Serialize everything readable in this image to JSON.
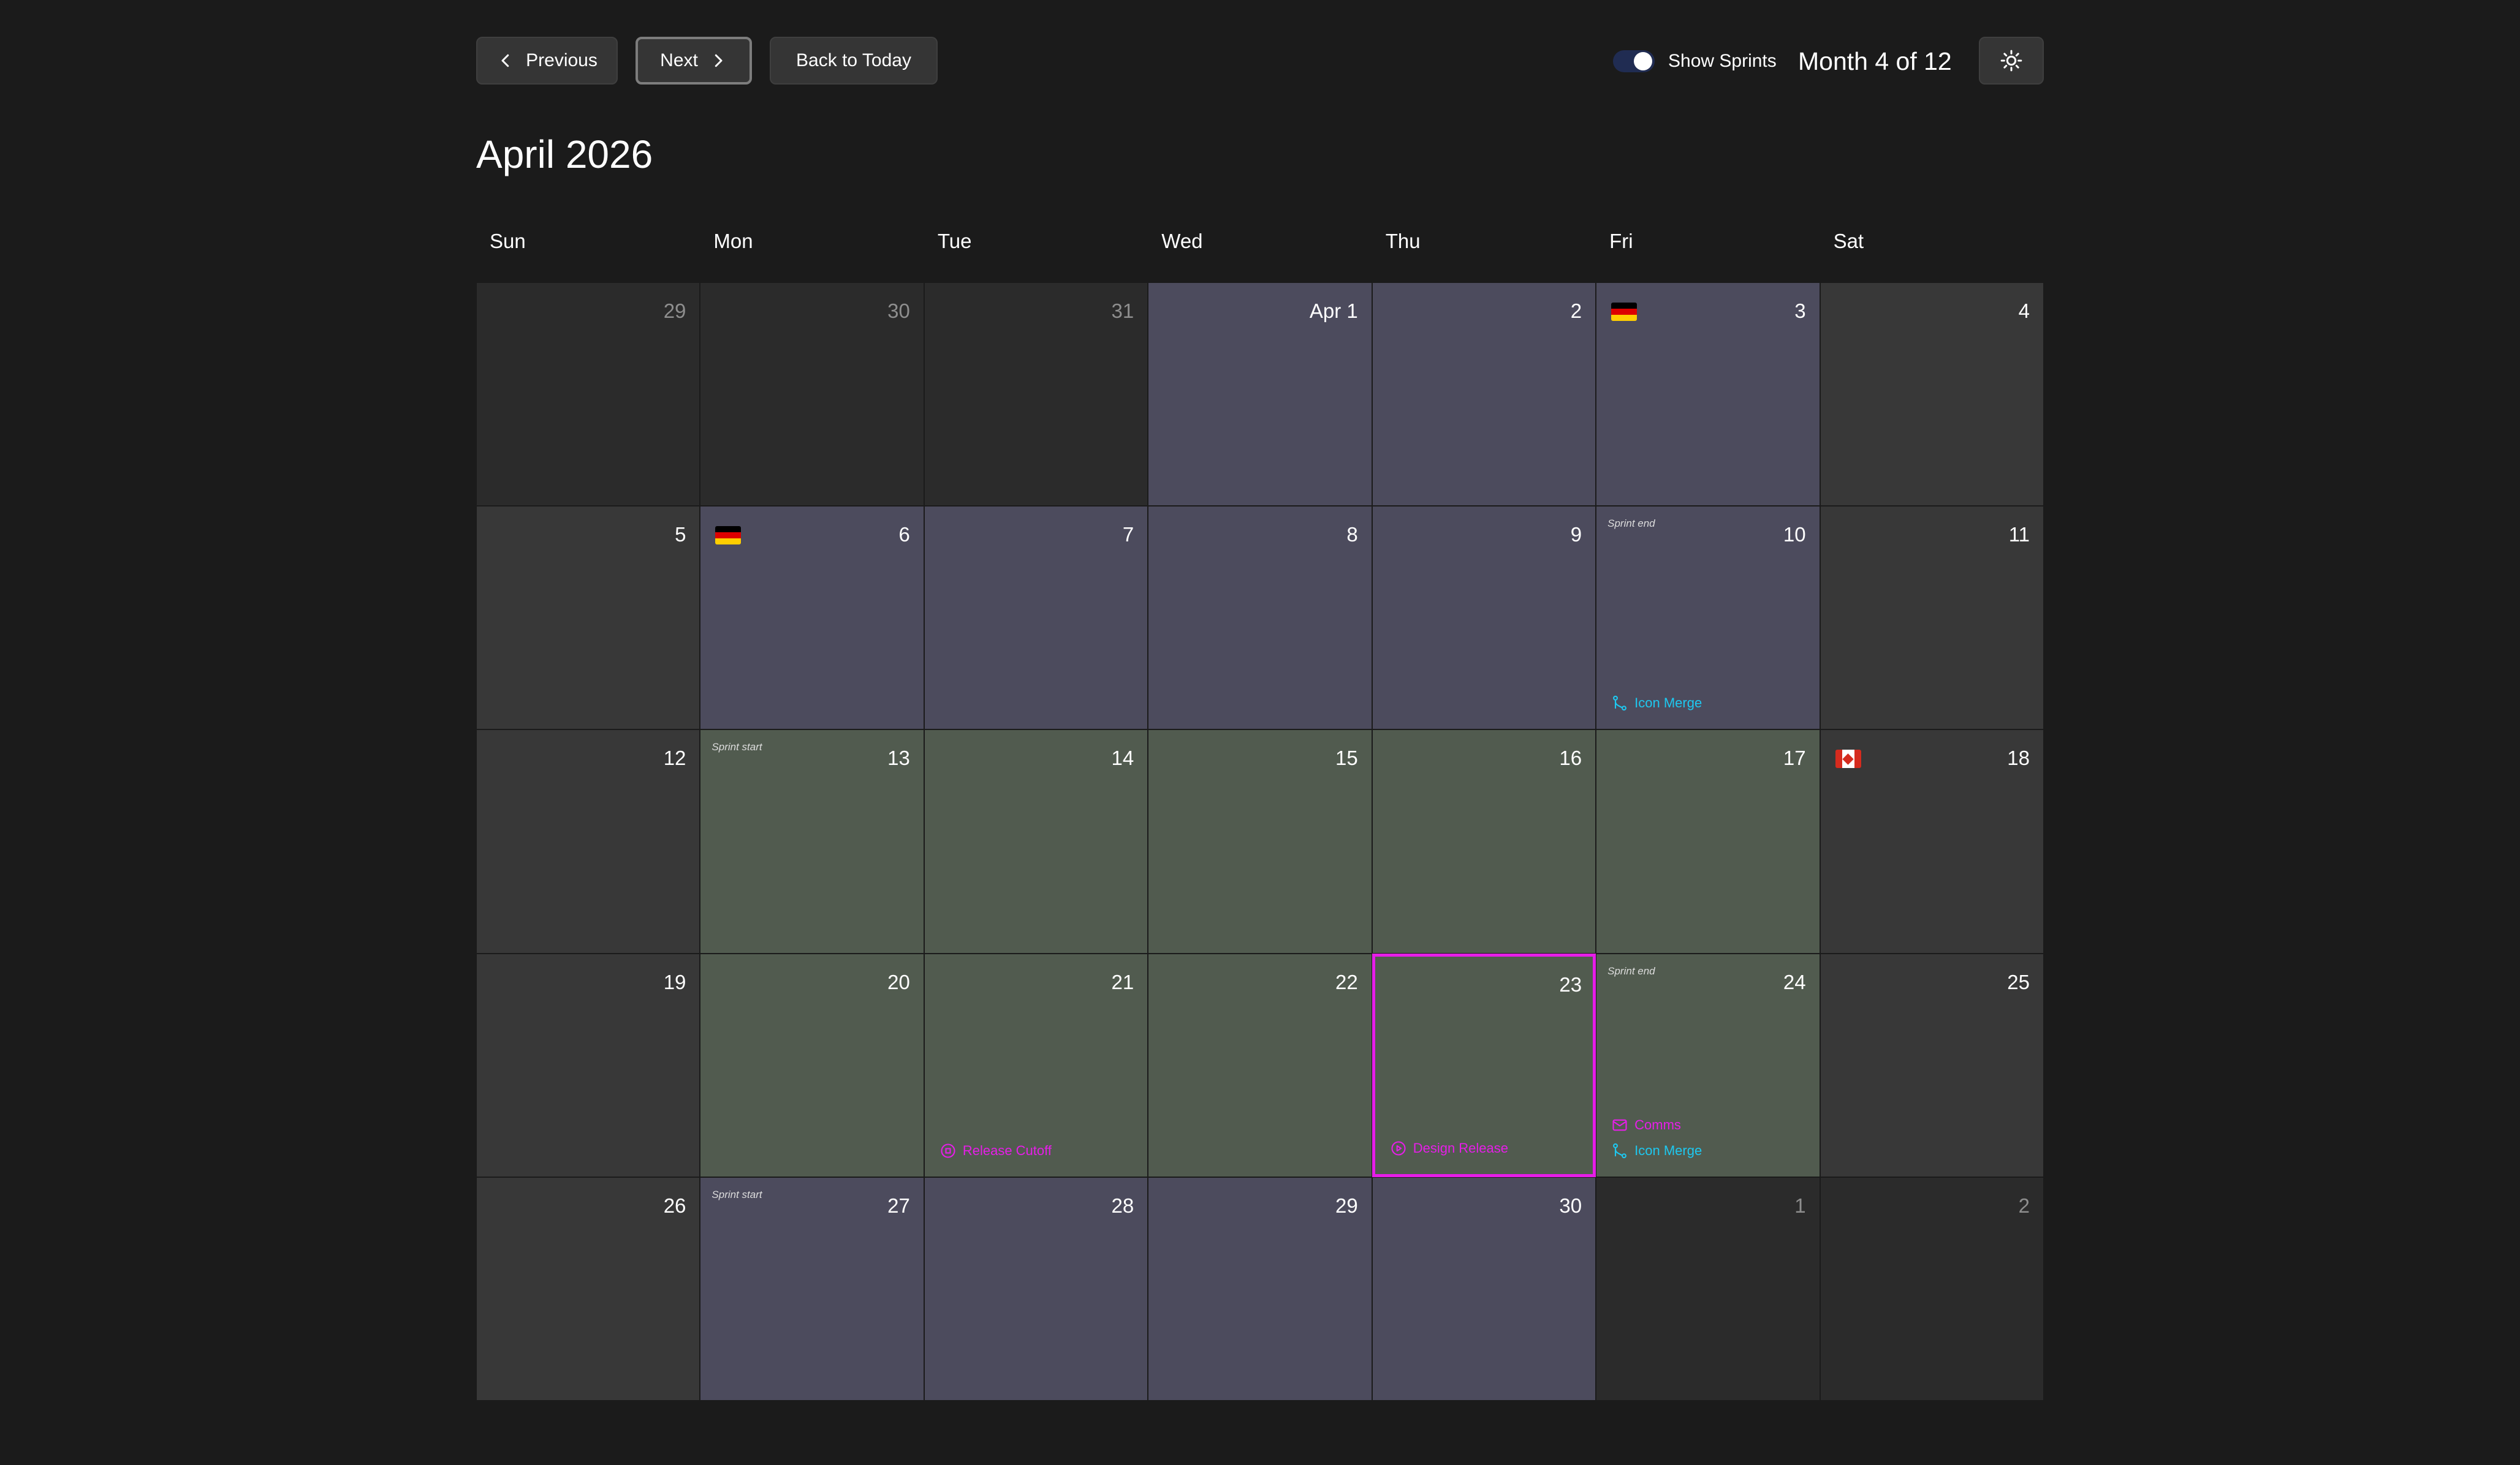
{
  "toolbar": {
    "previous_label": "Previous",
    "next_label": "Next",
    "today_label": "Back to Today",
    "show_sprints_label": "Show Sprints",
    "show_sprints_on": true,
    "month_counter": "Month 4 of 12",
    "theme_icon": "sun-icon"
  },
  "month_title": "April 2026",
  "weekdays": [
    "Sun",
    "Mon",
    "Tue",
    "Wed",
    "Thu",
    "Fri",
    "Sat"
  ],
  "colors": {
    "background": "#1b1b1b",
    "outside_day": "#2b2b2b",
    "weekend_day": "#383838",
    "sprint_a": "#4c4b5d",
    "sprint_b": "#515b4f",
    "today_border": "#e61ee8",
    "event_cyan": "#1ec8f0",
    "event_magenta": "#e61ee8"
  },
  "weeks": [
    [
      {
        "day": "29",
        "kind": "outside"
      },
      {
        "day": "30",
        "kind": "outside"
      },
      {
        "day": "31",
        "kind": "outside"
      },
      {
        "day": "Apr 1",
        "kind": "sprint-a"
      },
      {
        "day": "2",
        "kind": "sprint-a"
      },
      {
        "day": "3",
        "kind": "sprint-a",
        "flag": "de"
      },
      {
        "day": "4",
        "kind": "weekend"
      }
    ],
    [
      {
        "day": "5",
        "kind": "weekend"
      },
      {
        "day": "6",
        "kind": "sprint-a",
        "flag": "de"
      },
      {
        "day": "7",
        "kind": "sprint-a"
      },
      {
        "day": "8",
        "kind": "sprint-a"
      },
      {
        "day": "9",
        "kind": "sprint-a"
      },
      {
        "day": "10",
        "kind": "sprint-a",
        "sprint_tag": "Sprint end",
        "events": [
          {
            "label": "Icon Merge",
            "icon": "merge-icon",
            "color": "cyan"
          }
        ]
      },
      {
        "day": "11",
        "kind": "weekend"
      }
    ],
    [
      {
        "day": "12",
        "kind": "weekend"
      },
      {
        "day": "13",
        "kind": "sprint-b",
        "sprint_tag": "Sprint start"
      },
      {
        "day": "14",
        "kind": "sprint-b"
      },
      {
        "day": "15",
        "kind": "sprint-b"
      },
      {
        "day": "16",
        "kind": "sprint-b"
      },
      {
        "day": "17",
        "kind": "sprint-b"
      },
      {
        "day": "18",
        "kind": "weekend",
        "flag": "ca"
      }
    ],
    [
      {
        "day": "19",
        "kind": "weekend"
      },
      {
        "day": "20",
        "kind": "sprint-b"
      },
      {
        "day": "21",
        "kind": "sprint-b",
        "events": [
          {
            "label": "Release Cutoff",
            "icon": "stop-circle-icon",
            "color": "magenta"
          }
        ]
      },
      {
        "day": "22",
        "kind": "sprint-b"
      },
      {
        "day": "23",
        "kind": "sprint-b",
        "today": true,
        "events": [
          {
            "label": "Design Release",
            "icon": "play-circle-icon",
            "color": "magenta"
          }
        ]
      },
      {
        "day": "24",
        "kind": "sprint-b",
        "sprint_tag": "Sprint end",
        "events": [
          {
            "label": "Comms",
            "icon": "mail-icon",
            "color": "magenta"
          },
          {
            "label": "Icon Merge",
            "icon": "merge-icon",
            "color": "cyan"
          }
        ]
      },
      {
        "day": "25",
        "kind": "weekend"
      }
    ],
    [
      {
        "day": "26",
        "kind": "weekend"
      },
      {
        "day": "27",
        "kind": "sprint-a",
        "sprint_tag": "Sprint start"
      },
      {
        "day": "28",
        "kind": "sprint-a"
      },
      {
        "day": "29",
        "kind": "sprint-a"
      },
      {
        "day": "30",
        "kind": "sprint-a"
      },
      {
        "day": "1",
        "kind": "outside"
      },
      {
        "day": "2",
        "kind": "outside"
      }
    ]
  ]
}
